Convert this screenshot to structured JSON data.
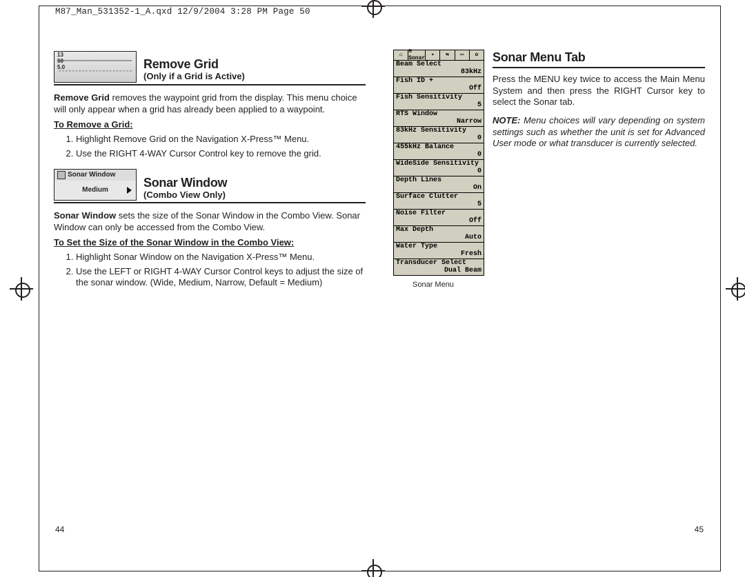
{
  "fileinfo": "M87_Man_531352-1_A.qxd  12/9/2004  3:28 PM  Page 50",
  "page_left": "44",
  "page_right": "45",
  "left": {
    "s1": {
      "title": "Remove Grid",
      "sub": "(Only if a Grid is Active)",
      "thumb_sw_label": "Sonar Window",
      "thumb_sw_value": "Medium",
      "para_lead": "Remove Grid",
      "para_rest": " removes the waypoint grid from the display. This menu choice will only appear when a grid has already been applied to a waypoint.",
      "howto": "To Remove a Grid:",
      "step1": "Highlight Remove Grid on the Navigation X-Press™ Menu.",
      "step2": "Use the RIGHT 4-WAY Cursor Control key to remove the grid."
    },
    "s2": {
      "title": "Sonar Window",
      "sub": "(Combo View Only)",
      "para_lead": "Sonar Window",
      "para_rest": " sets the size of the Sonar Window in the Combo View. Sonar Window can only be accessed from the Combo View.",
      "howto": "To Set the Size of the Sonar Window in the Combo View:",
      "step1": "Highlight Sonar Window on the Navigation X-Press™ Menu.",
      "step2": "Use the LEFT or RIGHT 4-WAY Cursor Control keys to adjust the size of the sonar window. (Wide, Medium, Narrow, Default = Medium)"
    }
  },
  "right": {
    "title": "Sonar Menu Tab",
    "intro": "Press the MENU key twice to access the Main Menu System and then press the RIGHT Cursor key to select the Sonar tab.",
    "note_label": "NOTE:",
    "note": " Menu choices will vary depending on system settings such as whether the unit is set for Advanced User mode or what transducer is currently selected.",
    "lcd_caption": "Sonar Menu",
    "tabs": [
      "⌂",
      "≋ Sonar",
      "✦",
      "⇆",
      "▭",
      "✿"
    ],
    "menu": [
      {
        "k": "Beam Select",
        "v": "83kHz"
      },
      {
        "k": "Fish ID +",
        "v": "Off"
      },
      {
        "k": "Fish Sensitivity",
        "v": "5"
      },
      {
        "k": "RTS Window",
        "v": "Narrow"
      },
      {
        "k": "83kHz Sensitivity",
        "v": "0"
      },
      {
        "k": "455kHz Balance",
        "v": "0"
      },
      {
        "k": "WideSide Sensitivity",
        "v": "0"
      },
      {
        "k": "Depth Lines",
        "v": "On"
      },
      {
        "k": "Surface Clutter",
        "v": "5"
      },
      {
        "k": "Noise Filter",
        "v": "Off"
      },
      {
        "k": "Max Depth",
        "v": "Auto"
      },
      {
        "k": "Water Type",
        "v": "Fresh"
      },
      {
        "k": "Transducer Select",
        "v": "Dual Beam"
      }
    ]
  }
}
